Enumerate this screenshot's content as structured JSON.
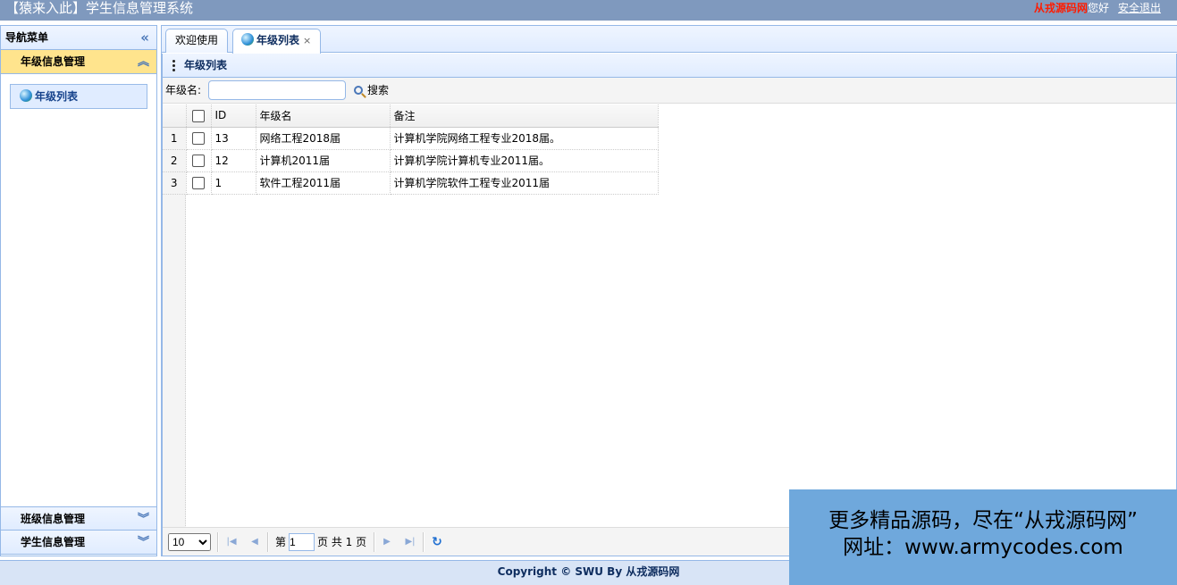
{
  "header": {
    "title": "【猿来入此】学生信息管理系统",
    "site_name": "从戎源码网",
    "greeting": "您好",
    "logout": "安全退出"
  },
  "west": {
    "title": "导航菜单",
    "sections": [
      {
        "label": "年级信息管理",
        "expanded": true,
        "items": [
          {
            "label": "年级列表"
          }
        ]
      },
      {
        "label": "班级信息管理",
        "expanded": false
      },
      {
        "label": "学生信息管理",
        "expanded": false
      }
    ]
  },
  "tabs": [
    {
      "label": "欢迎使用",
      "closable": false
    },
    {
      "label": "年级列表",
      "closable": true,
      "selected": true,
      "close_glyph": "×"
    }
  ],
  "grid": {
    "title": "年级列表",
    "search_label": "年级名:",
    "search_value": "",
    "search_button": "搜索",
    "columns": [
      "ID",
      "年级名",
      "备注"
    ],
    "rows": [
      {
        "num": "1",
        "id": "13",
        "name": "网络工程2018届",
        "note": "计算机学院网络工程专业2018届。"
      },
      {
        "num": "2",
        "id": "12",
        "name": "计算机2011届",
        "note": "计算机学院计算机专业2011届。"
      },
      {
        "num": "3",
        "id": "1",
        "name": "软件工程2011届",
        "note": "计算机学院软件工程专业2011届"
      }
    ]
  },
  "pager": {
    "page_size": "10",
    "page_size_options": [
      "10"
    ],
    "page_prefix": "第",
    "current_page": "1",
    "page_suffix": "页 共 1 页"
  },
  "footer": {
    "copyright": "Copyright © SWU By 从戎源码网"
  },
  "watermark": {
    "line1": "更多精品源码，尽在“从戎源码网”",
    "line2": "网址：www.armycodes.com"
  }
}
